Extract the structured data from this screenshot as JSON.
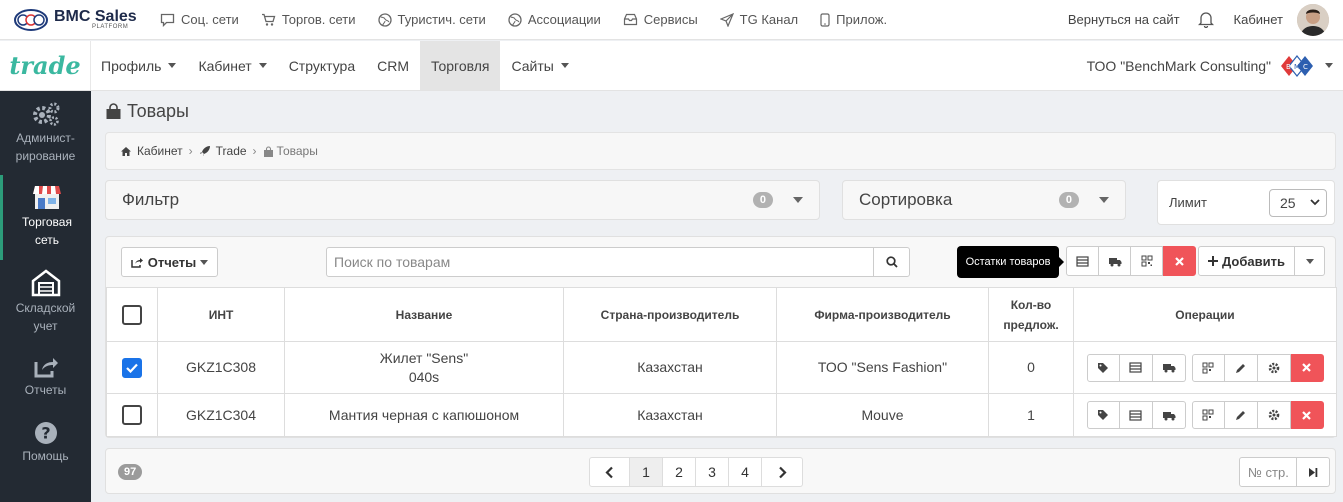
{
  "topbar": {
    "logo_text": "BMC Sales",
    "logo_sub": "PLATFORM",
    "links": [
      {
        "label": "Соц. сети",
        "icon": "chat-icon"
      },
      {
        "label": "Торгов. сети",
        "icon": "cart-icon"
      },
      {
        "label": "Туристич. сети",
        "icon": "globe-icon"
      },
      {
        "label": "Ассоциации",
        "icon": "globe-icon"
      },
      {
        "label": "Сервисы",
        "icon": "inbox-icon"
      },
      {
        "label": "TG Канал",
        "icon": "send-icon"
      },
      {
        "label": "Прилож.",
        "icon": "phone-icon"
      }
    ],
    "back_to_site": "Вернуться на сайт",
    "cabinet": "Кабинет"
  },
  "navbar": {
    "brand": "trade",
    "items": [
      {
        "label": "Профиль",
        "dropdown": true
      },
      {
        "label": "Кабинет",
        "dropdown": true
      },
      {
        "label": "Структура",
        "dropdown": false
      },
      {
        "label": "CRM",
        "dropdown": false
      },
      {
        "label": "Торговля",
        "dropdown": false,
        "active": true
      },
      {
        "label": "Сайты",
        "dropdown": true
      }
    ],
    "company": "ТОО \"BenchMark Consulting\""
  },
  "sidebar": {
    "items": [
      {
        "label": "Админист-рирование",
        "icon": "gears-icon"
      },
      {
        "label": "Торговая сеть",
        "icon": "store-icon",
        "active": true
      },
      {
        "label": "Складской учет",
        "icon": "warehouse-icon"
      },
      {
        "label": "Отчеты",
        "icon": "share-icon"
      },
      {
        "label": "Помощь",
        "icon": "help-icon"
      }
    ]
  },
  "page": {
    "title": "Товары",
    "breadcrumb": [
      "Кабинет",
      "Trade",
      "Товары"
    ]
  },
  "filter": {
    "label": "Фильтр",
    "count": "0"
  },
  "sort": {
    "label": "Сортировка",
    "count": "0"
  },
  "limit": {
    "label": "Лимит",
    "value": "25"
  },
  "toolbar": {
    "reports": "Отчеты",
    "search_placeholder": "Поиск по товарам",
    "tooltip": "Остатки товаров",
    "add": "Добавить"
  },
  "table": {
    "headers": [
      "ИНТ",
      "Название",
      "Страна-производитель",
      "Фирма-производитель",
      "Кол-во предлож.",
      "Операции"
    ],
    "rows": [
      {
        "checked": true,
        "int": "GKZ1C308",
        "name": "Жилет \"Sens\"",
        "name2": "040s",
        "country": "Казахстан",
        "firm": "ТОО \"Sens Fashion\"",
        "qty": "0"
      },
      {
        "checked": false,
        "int": "GKZ1C304",
        "name": "Мантия черная с капюшоном",
        "name2": "",
        "country": "Казахстан",
        "firm": "Mouve",
        "qty": "1"
      }
    ]
  },
  "footer": {
    "total": "97",
    "pages": [
      "1",
      "2",
      "3",
      "4"
    ],
    "current_page": "1",
    "page_input_placeholder": "№ стр."
  },
  "colors": {
    "accent": "#3bb8a0",
    "danger": "#f05459",
    "sidebar": "#232a33",
    "checkbox": "#1a73e8"
  }
}
